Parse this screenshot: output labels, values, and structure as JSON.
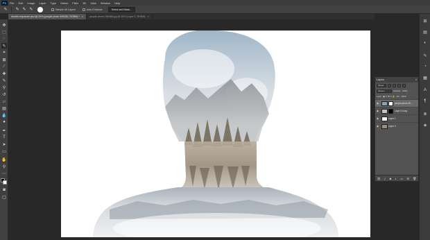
{
  "menubar": {
    "logo": "Ps",
    "items": [
      "File",
      "Edit",
      "Image",
      "Layer",
      "Type",
      "Select",
      "Filter",
      "3D",
      "View",
      "Window",
      "Help"
    ]
  },
  "options": {
    "brush_size": "",
    "sample_all_layers": "Sample All Layers",
    "auto_enhance": "Auto-Enhance",
    "select_and_mask": "Select and Mask..."
  },
  "tabs": [
    {
      "label": "double-exposure.psd @ 25% (people photo 494026, RGB/8) *",
      "close": "×"
    },
    {
      "label": "people-photo 266488.jpg @ 25% (Layer 0, RGB/8)",
      "close": "×"
    }
  ],
  "layers_panel": {
    "title": "Layers",
    "close": "«",
    "kind_label": "Kind",
    "blend_mode": "Screen",
    "opacity_label": "Opacity:",
    "opacity_value": "100%",
    "lock_label": "Lock:",
    "fill_label": "Fill:",
    "fill_value": "100%",
    "layers": [
      {
        "name": "people-photo 49...",
        "selected": true,
        "has_mask": true,
        "thumb_color": "#8aa0b5",
        "mask_color": "#ffffff"
      },
      {
        "name": "Layer 0 copy",
        "selected": false,
        "has_mask": true,
        "thumb_color": "#c8c4bc",
        "mask_color": "#000000"
      },
      {
        "name": "Layer 1",
        "selected": false,
        "has_mask": false,
        "thumb_color": "#ffffff"
      },
      {
        "name": "Layer 0",
        "selected": false,
        "has_mask": false,
        "thumb_color": "#9a8e80"
      }
    ],
    "footer_icons": [
      "link-icon",
      "fx-icon",
      "mask-icon",
      "adjustment-icon",
      "folder-icon",
      "new-layer-icon",
      "trash-icon"
    ]
  },
  "colors": {
    "foreground": "#000000",
    "background": "#ffffff",
    "accent": "#31a8ff"
  }
}
